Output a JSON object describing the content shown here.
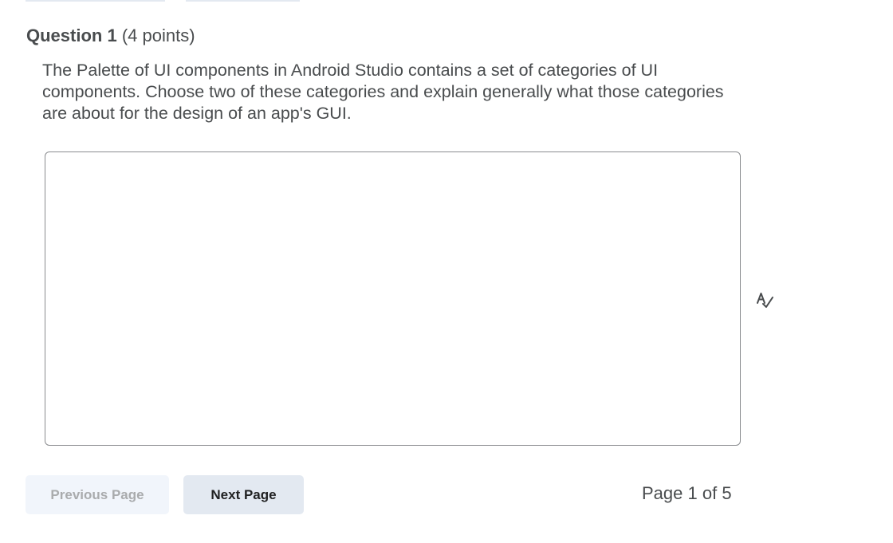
{
  "question": {
    "title": "Question 1",
    "points": "(4 points)",
    "text": "The Palette of UI components in Android Studio contains a set of categories of UI components. Choose two of these categories and explain generally what those categories are about for the design of an app's GUI."
  },
  "answer": {
    "value": "",
    "placeholder": ""
  },
  "icons": {
    "spellcheck": "spellcheck-icon"
  },
  "nav": {
    "previous_label": "Previous Page",
    "next_label": "Next Page",
    "previous_disabled": true
  },
  "pager": {
    "prefix": "Page",
    "current": "1",
    "separator": "of",
    "total": "5"
  },
  "colors": {
    "text": "#494c4e",
    "button_bg": "#e3e9f1",
    "button_disabled_bg": "#f1f5fb",
    "border": "#8a8c8f"
  }
}
